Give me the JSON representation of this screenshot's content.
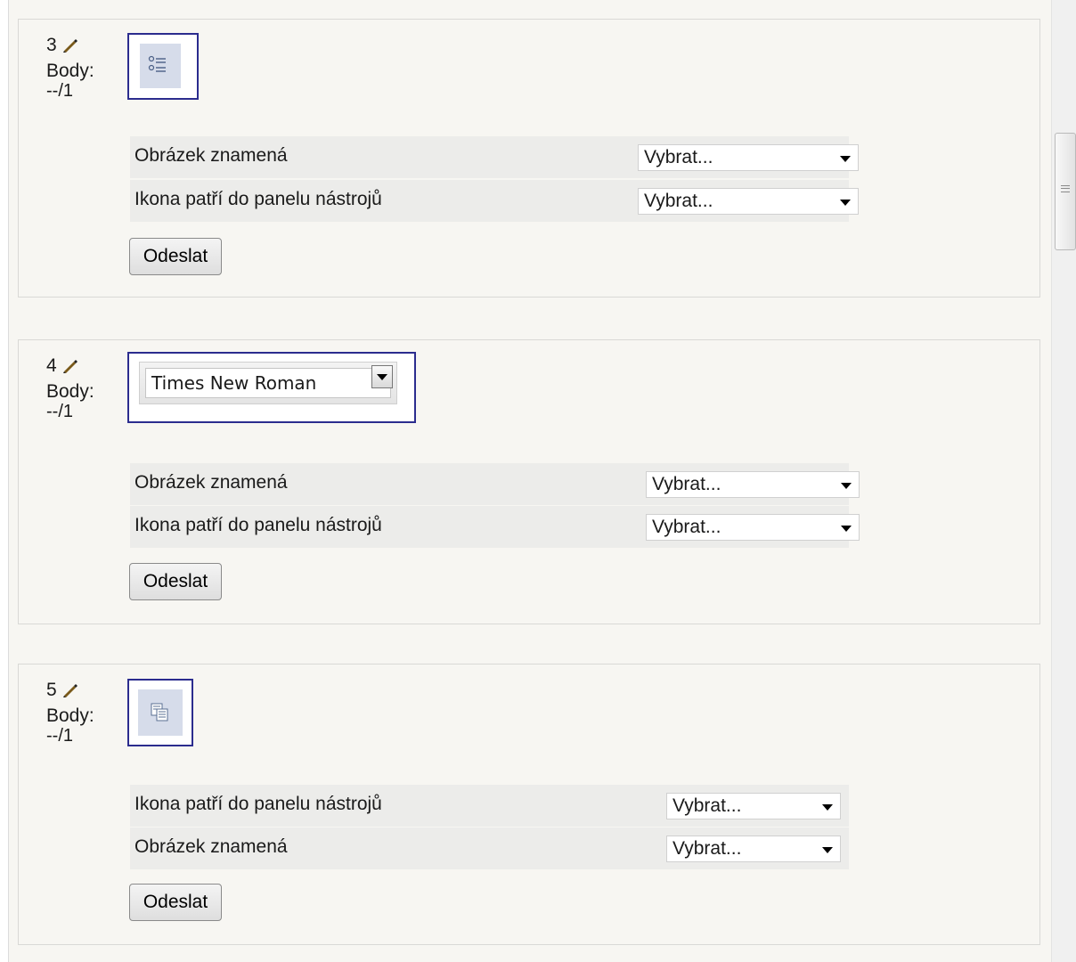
{
  "questions": [
    {
      "number": "3",
      "points_label": "Body:",
      "points_value": "--/1",
      "image_icon": "bulleted-list-icon",
      "rows": [
        {
          "label": "Obrázek znamená",
          "value": "Vybrat..."
        },
        {
          "label": "Ikona patří do panelu nástrojů",
          "value": "Vybrat..."
        }
      ],
      "submit_label": "Odeslat"
    },
    {
      "number": "4",
      "points_label": "Body:",
      "points_value": "--/1",
      "image_font_name": "Times New Roman",
      "rows": [
        {
          "label": "Obrázek znamená",
          "value": "Vybrat..."
        },
        {
          "label": "Ikona patří do panelu nástrojů",
          "value": "Vybrat..."
        }
      ],
      "submit_label": "Odeslat"
    },
    {
      "number": "5",
      "points_label": "Body:",
      "points_value": "--/1",
      "image_icon": "copy-icon",
      "rows": [
        {
          "label": "Ikona patří do panelu nástrojů",
          "value": "Vybrat..."
        },
        {
          "label": "Obrázek znamená",
          "value": "Vybrat..."
        }
      ],
      "submit_label": "Odeslat"
    }
  ],
  "icons": {
    "edit": "edit-pencil-icon"
  },
  "colors": {
    "frame": "#2b2c8e",
    "panel_bg": "#f7f6f2",
    "row_alt": "#ececea"
  }
}
